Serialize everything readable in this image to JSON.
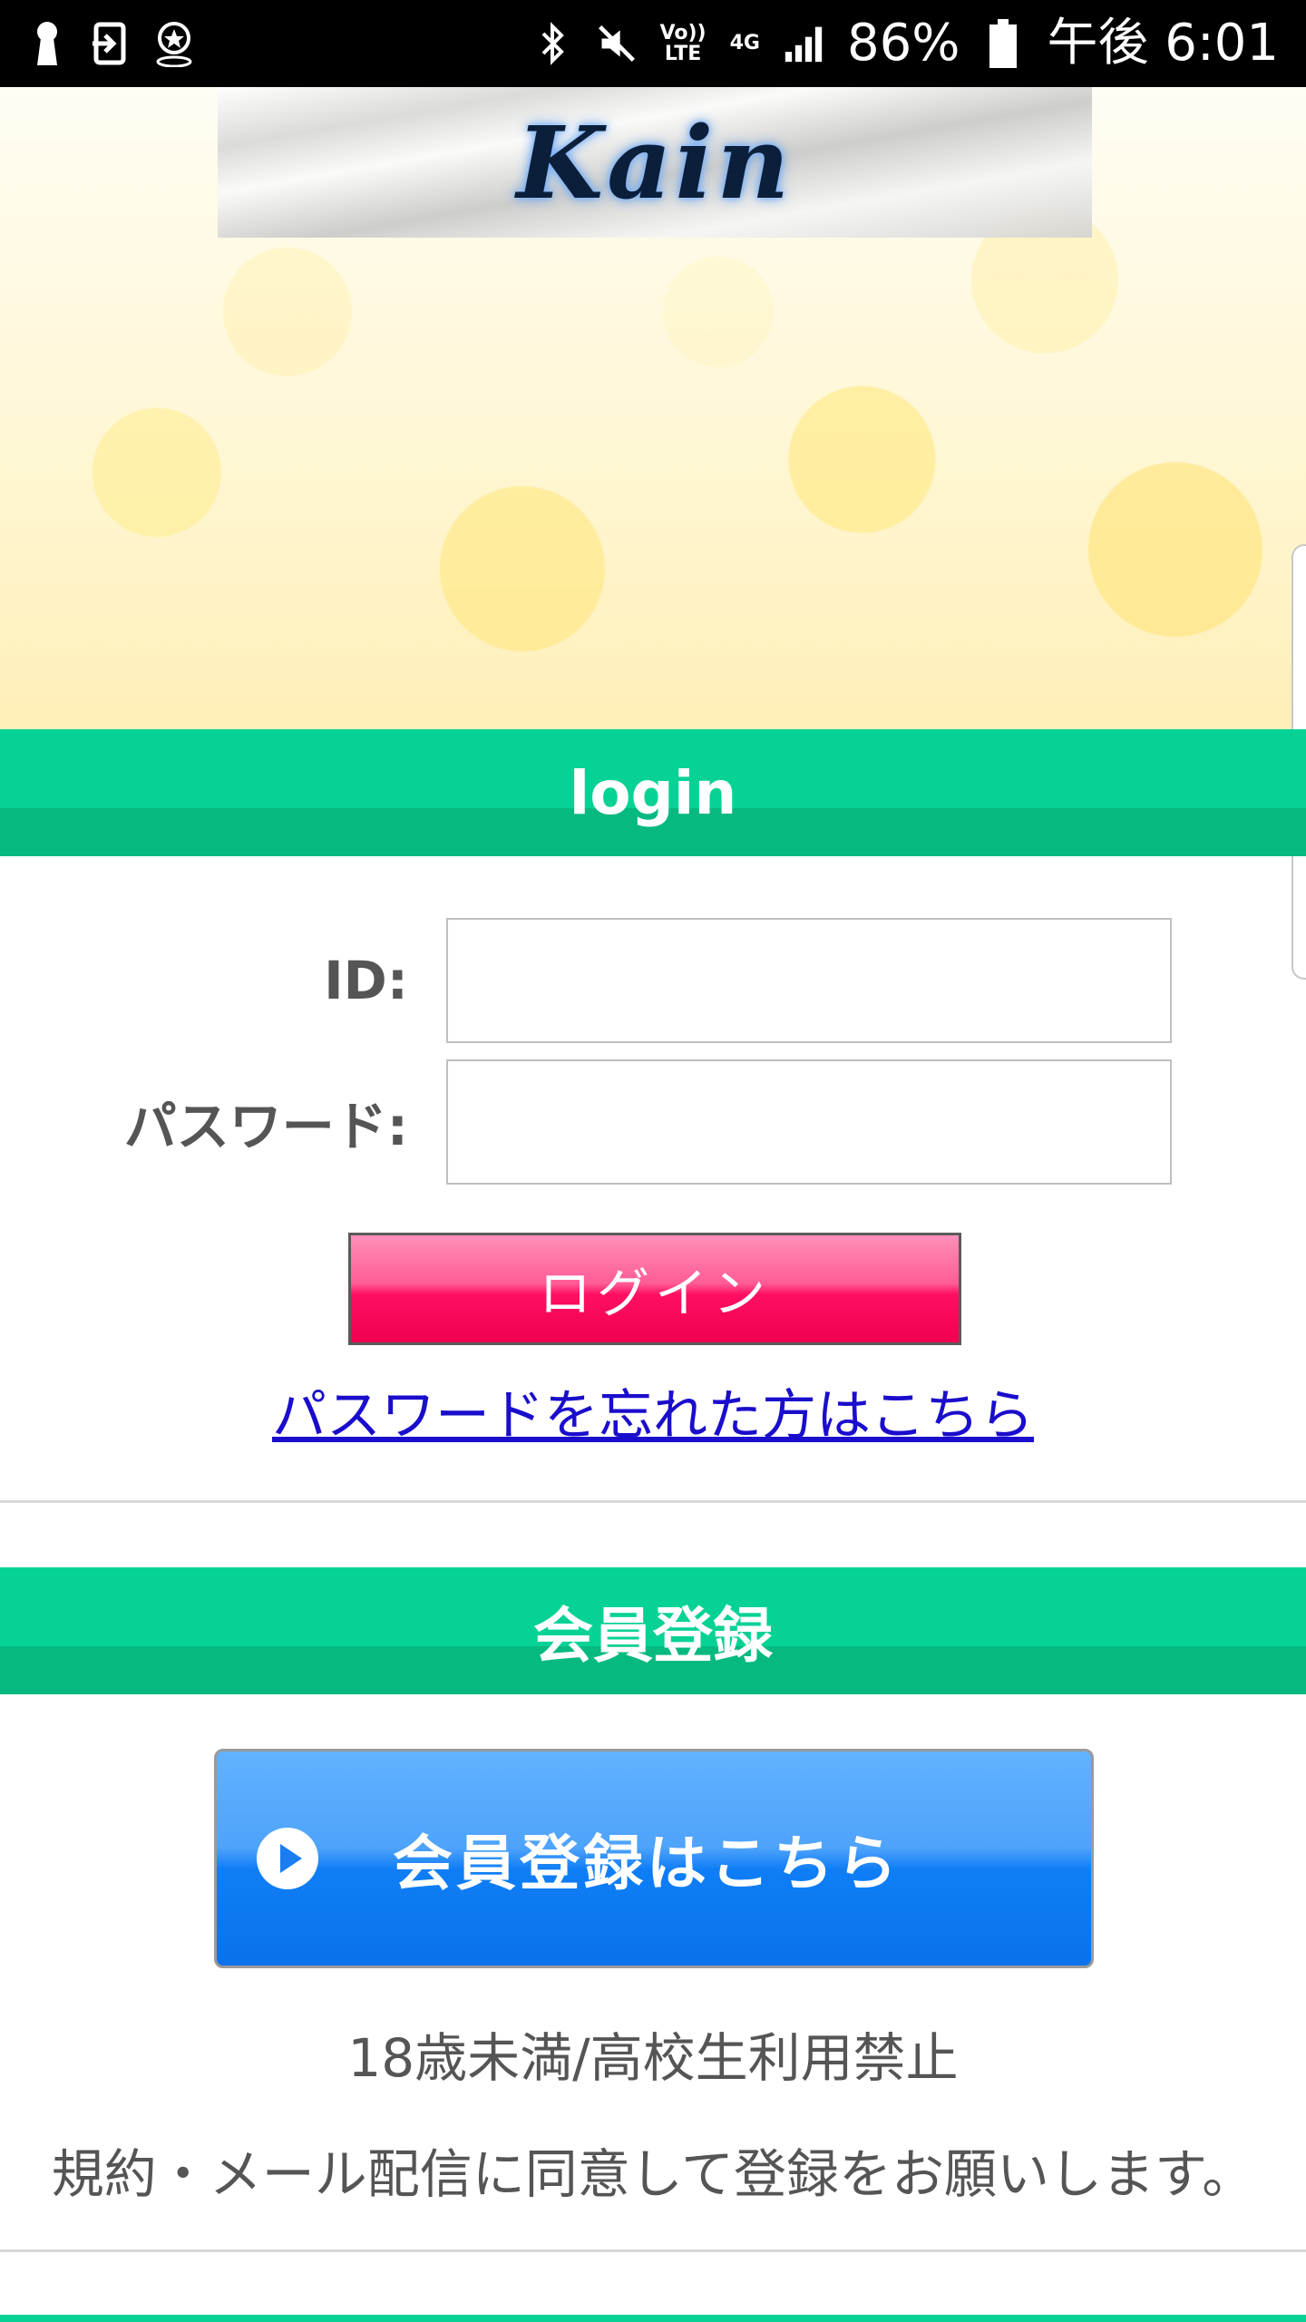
{
  "status_bar": {
    "battery": "86%",
    "time": "午後 6:01",
    "volte_line1": "Vo))",
    "volte_line2": "LTE",
    "network": "4G"
  },
  "hero": {
    "logo_text": "Kain"
  },
  "login_section": {
    "header": "login",
    "id_label": "ID:",
    "password_label": "パスワード:",
    "id_value": "",
    "password_value": "",
    "login_button": "ログイン",
    "forgot_link": "パスワードを忘れた方はこちら"
  },
  "register_section": {
    "header": "会員登録",
    "register_button": "会員登録はこちら",
    "age_notice": "18歳未満/高校生利用禁止",
    "agree_notice": "規約・メール配信に同意して登録をお願いします。"
  },
  "colors": {
    "section_green": "#07d296",
    "login_pink": "#ff0f63",
    "register_blue": "#0f7ef6",
    "link_blue": "#1a0dcc"
  }
}
